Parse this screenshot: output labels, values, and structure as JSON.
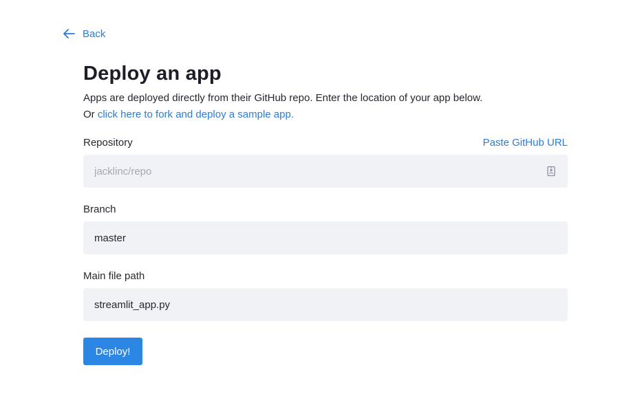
{
  "nav": {
    "back_label": "Back"
  },
  "header": {
    "title": "Deploy an app",
    "description_line1": "Apps are deployed directly from their GitHub repo. Enter the location of your app below.",
    "description_or": "Or ",
    "fork_link": "click here to fork and deploy a sample app."
  },
  "form": {
    "repository": {
      "label": "Repository",
      "paste_link": "Paste GitHub URL",
      "value": "",
      "placeholder": "jacklinc/repo"
    },
    "branch": {
      "label": "Branch",
      "value": "master",
      "placeholder": ""
    },
    "main_file": {
      "label": "Main file path",
      "value": "streamlit_app.py",
      "placeholder": ""
    },
    "deploy_label": "Deploy!"
  },
  "icons": {
    "back": "arrow-left-icon",
    "autofill": "contact-card-icon"
  },
  "colors": {
    "accent": "#2b7bd8",
    "button": "#2b87e3",
    "input_bg": "#f0f2f6",
    "text": "#262730"
  }
}
